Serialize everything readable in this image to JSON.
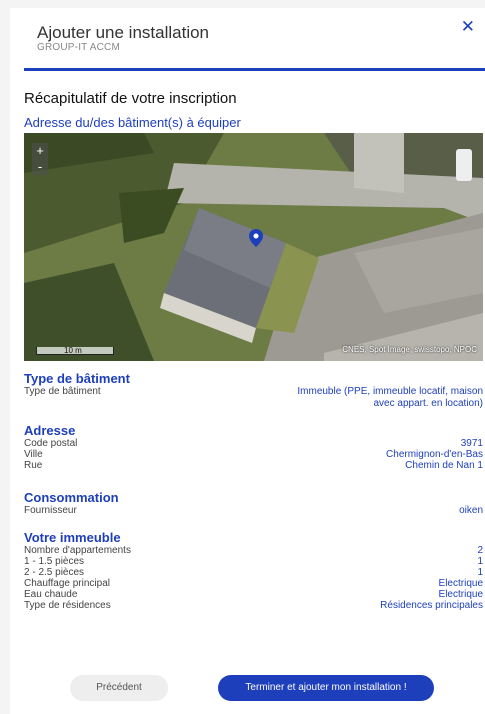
{
  "dialog": {
    "title": "Ajouter une installation",
    "subtitle": "GROUP-IT ACCM",
    "close_symbol": "✕"
  },
  "recap_title": "Récapitulatif de votre inscription",
  "address_section_title": "Adresse du/des bâtiment(s) à équiper",
  "map": {
    "zoom_in": "+",
    "zoom_out": "-",
    "scale_label": "10 m",
    "credit": "CNES, Spot Image, swisstopo, NPOC",
    "marker_icon": "map-pin-icon"
  },
  "building_type": {
    "heading": "Type de bâtiment",
    "label": "Type de bâtiment",
    "value_line1": "Immeuble (PPE, immeuble locatif, maison",
    "value_line2": "avec appart. en location)"
  },
  "address": {
    "heading": "Adresse",
    "rows": [
      {
        "label": "Code postal",
        "value": "3971"
      },
      {
        "label": "Ville",
        "value": "Chermignon-d'en-Bas"
      },
      {
        "label": "Rue",
        "value": "Chemin de Nan 1"
      }
    ]
  },
  "consumption": {
    "heading": "Consommation",
    "rows": [
      {
        "label": "Fournisseur",
        "value": "oiken"
      }
    ]
  },
  "building": {
    "heading": "Votre immeuble",
    "rows": [
      {
        "label": "Nombre d'appartements",
        "value": "2"
      },
      {
        "label": "1 - 1.5 pièces",
        "value": "1"
      },
      {
        "label": "2 - 2.5 pièces",
        "value": "1"
      },
      {
        "label": "Chauffage principal",
        "value": "Electrique"
      },
      {
        "label": "Eau chaude",
        "value": "Electrique"
      },
      {
        "label": "Type de résidences",
        "value": "Résidences principales"
      }
    ]
  },
  "buttons": {
    "previous": "Précédent",
    "finish": "Terminer et ajouter mon installation !"
  },
  "colors": {
    "accent": "#1e3fbb"
  }
}
